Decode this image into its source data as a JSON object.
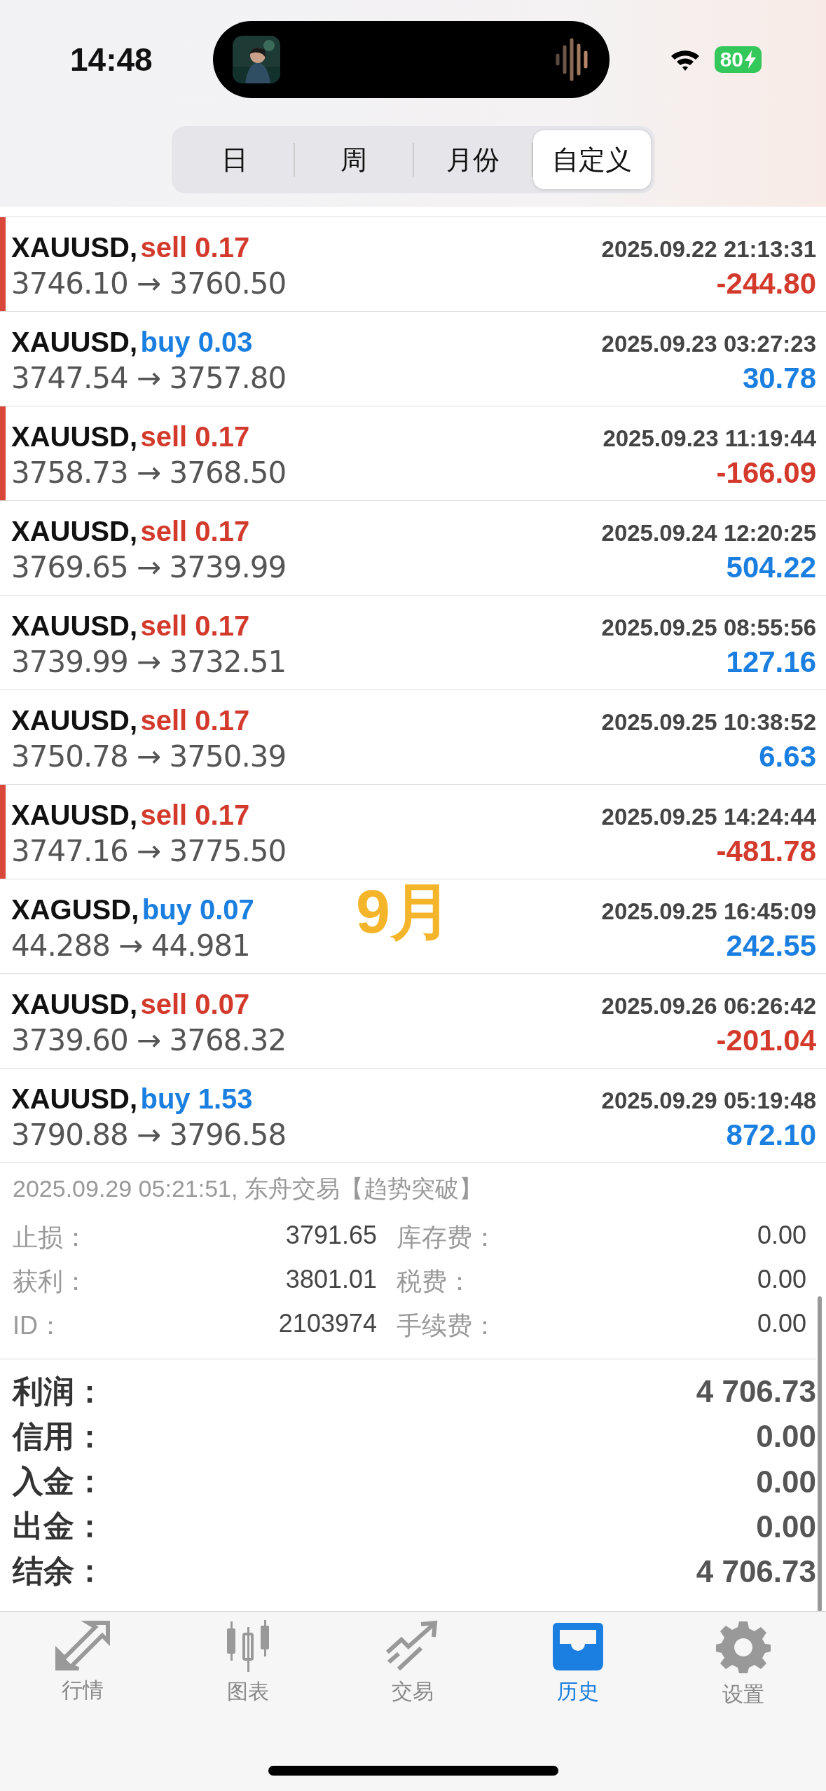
{
  "status_bar": {
    "time": "14:48",
    "battery": "80"
  },
  "period_tabs": [
    {
      "label": "日",
      "selected": false
    },
    {
      "label": "周",
      "selected": false
    },
    {
      "label": "月份",
      "selected": false
    },
    {
      "label": "自定义",
      "selected": true
    }
  ],
  "deals": [
    {
      "symbol": "XAUUSD,",
      "kind": "sell",
      "order": "sell 0.17",
      "time": "2025.09.22 21:13:31",
      "prices": "3746.10 → 3760.50",
      "profit": "-244.80",
      "loss": true,
      "marked": true
    },
    {
      "symbol": "XAUUSD,",
      "kind": "buy",
      "order": "buy 0.03",
      "time": "2025.09.23 03:27:23",
      "prices": "3747.54 → 3757.80",
      "profit": "30.78",
      "loss": false,
      "marked": false
    },
    {
      "symbol": "XAUUSD,",
      "kind": "sell",
      "order": "sell 0.17",
      "time": "2025.09.23 11:19:44",
      "prices": "3758.73 → 3768.50",
      "profit": "-166.09",
      "loss": true,
      "marked": true
    },
    {
      "symbol": "XAUUSD,",
      "kind": "sell",
      "order": "sell 0.17",
      "time": "2025.09.24 12:20:25",
      "prices": "3769.65 → 3739.99",
      "profit": "504.22",
      "loss": false,
      "marked": false
    },
    {
      "symbol": "XAUUSD,",
      "kind": "sell",
      "order": "sell 0.17",
      "time": "2025.09.25 08:55:56",
      "prices": "3739.99 → 3732.51",
      "profit": "127.16",
      "loss": false,
      "marked": false
    },
    {
      "symbol": "XAUUSD,",
      "kind": "sell",
      "order": "sell 0.17",
      "time": "2025.09.25 10:38:52",
      "prices": "3750.78 → 3750.39",
      "profit": "6.63",
      "loss": false,
      "marked": false
    },
    {
      "symbol": "XAUUSD,",
      "kind": "sell",
      "order": "sell 0.17",
      "time": "2025.09.25 14:24:44",
      "prices": "3747.16 → 3775.50",
      "profit": "-481.78",
      "loss": true,
      "marked": true
    },
    {
      "symbol": "XAGUSD,",
      "kind": "buy",
      "order": "buy 0.07",
      "time": "2025.09.25 16:45:09",
      "prices": "44.288 → 44.981",
      "profit": "242.55",
      "loss": false,
      "marked": false,
      "annotation": "9月"
    },
    {
      "symbol": "XAUUSD,",
      "kind": "sell",
      "order": "sell 0.07",
      "time": "2025.09.26 06:26:42",
      "prices": "3739.60 → 3768.32",
      "profit": "-201.04",
      "loss": true,
      "marked": false
    },
    {
      "symbol": "XAUUSD,",
      "kind": "buy",
      "order": "buy 1.53",
      "time": "2025.09.29 05:19:48",
      "prices": "3790.88 → 3796.58",
      "profit": "872.10",
      "loss": false,
      "marked": false
    }
  ],
  "order_detail": {
    "header": "2025.09.29 05:21:51, 东舟交易【趋势突破】",
    "fields": [
      {
        "label": "止损：",
        "value": "3791.65"
      },
      {
        "label": "库存费：",
        "value": "0.00"
      },
      {
        "label": "获利：",
        "value": "3801.01"
      },
      {
        "label": "税费：",
        "value": "0.00"
      },
      {
        "label": "ID：",
        "value": "2103974"
      },
      {
        "label": "手续费：",
        "value": "0.00"
      }
    ]
  },
  "summary": [
    {
      "label": "利润：",
      "value": "4 706.73"
    },
    {
      "label": "信用：",
      "value": "0.00"
    },
    {
      "label": "入金：",
      "value": "0.00"
    },
    {
      "label": "出金：",
      "value": "0.00"
    },
    {
      "label": "结余：",
      "value": "4 706.73"
    }
  ],
  "tab_bar": [
    {
      "label": "行情",
      "selected": false
    },
    {
      "label": "图表",
      "selected": false
    },
    {
      "label": "交易",
      "selected": false
    },
    {
      "label": "历史",
      "selected": true
    },
    {
      "label": "设置",
      "selected": false
    }
  ]
}
